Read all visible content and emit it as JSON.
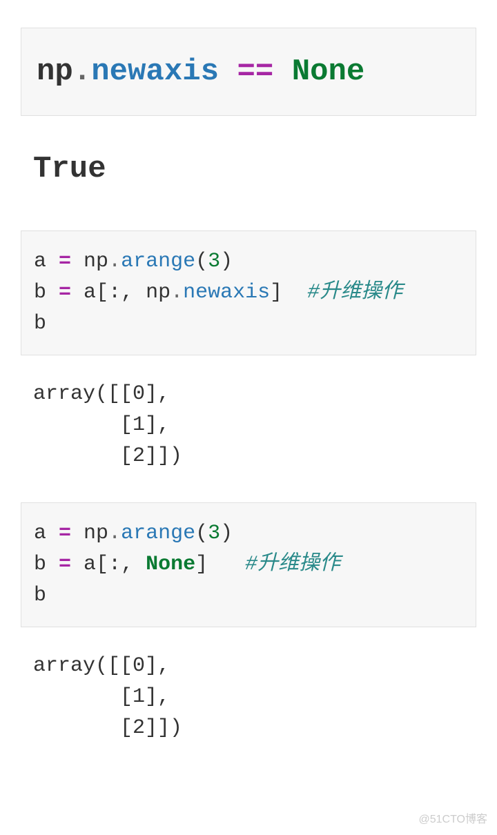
{
  "cell1": {
    "np": "np",
    "dot": ".",
    "attr": "newaxis",
    "op": " == ",
    "none": "None"
  },
  "out1": "True",
  "cell2": {
    "l1_a": "a ",
    "l1_eq": "=",
    "l1_sp": " ",
    "l1_np": "np",
    "l1_dot": ".",
    "l1_func": "arange",
    "l1_open": "(",
    "l1_num": "3",
    "l1_close": ")",
    "l2_b": "b ",
    "l2_eq": "=",
    "l2_sp": " ",
    "l2_a": "a",
    "l2_lb": "[",
    "l2_slice": ":, ",
    "l2_np": "np",
    "l2_dot": ".",
    "l2_attr": "newaxis",
    "l2_rb": "]",
    "l2_pad": "  ",
    "l2_comment": "#升维操作",
    "l3": "b"
  },
  "out2": "array([[0],\n       [1],\n       [2]])",
  "cell3": {
    "l1_a": "a ",
    "l1_eq": "=",
    "l1_sp": " ",
    "l1_np": "np",
    "l1_dot": ".",
    "l1_func": "arange",
    "l1_open": "(",
    "l1_num": "3",
    "l1_close": ")",
    "l2_b": "b ",
    "l2_eq": "=",
    "l2_sp": " ",
    "l2_a": "a",
    "l2_lb": "[",
    "l2_slice": ":, ",
    "l2_none": "None",
    "l2_rb": "]",
    "l2_pad": "   ",
    "l2_comment": "#升维操作",
    "l3": "b"
  },
  "out3": "array([[0],\n       [1],\n       [2]])",
  "watermark": "@51CTO博客"
}
